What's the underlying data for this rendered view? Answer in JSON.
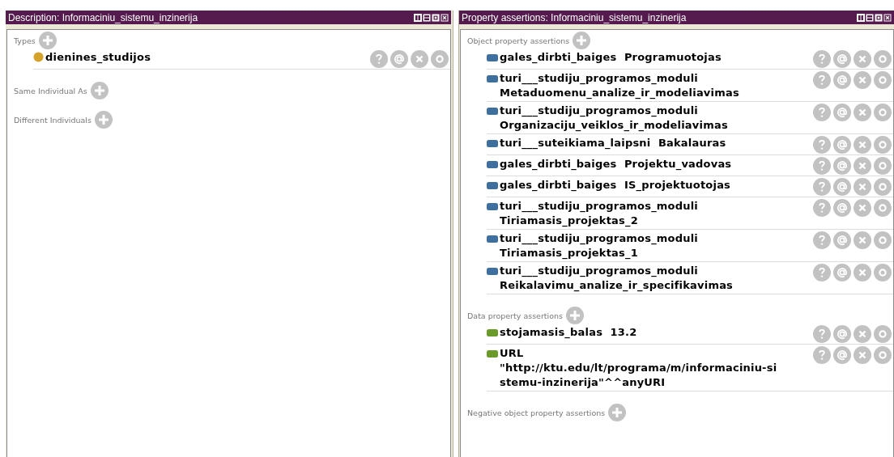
{
  "panels": [
    {
      "title": "Description: Informaciniu_sistemu_inzinerija",
      "sections": [
        {
          "label": "Types",
          "kind": "class",
          "rows": [
            {
              "lines": [
                "dienines_studijos"
              ]
            }
          ]
        },
        {
          "label": "Same Individual As"
        },
        {
          "label": "Different Individuals"
        }
      ]
    },
    {
      "title": "Property assertions: Informaciniu_sistemu_inzinerija",
      "sections": [
        {
          "label": "Object property assertions",
          "kind": "object",
          "rows": [
            {
              "lines": [
                "gales_dirbti_baiges  Programuotojas"
              ]
            },
            {
              "lines": [
                "turi___studiju_programos_moduli",
                "Metaduomenu_analize_ir_modeliavimas"
              ]
            },
            {
              "lines": [
                "turi___studiju_programos_moduli",
                "Organizaciju_veiklos_ir_modeliavimas"
              ]
            },
            {
              "lines": [
                "turi___suteikiama_laipsni  Bakalauras"
              ]
            },
            {
              "lines": [
                "gales_dirbti_baiges  Projektu_vadovas"
              ]
            },
            {
              "lines": [
                "gales_dirbti_baiges  IS_projektuotojas"
              ]
            },
            {
              "lines": [
                "turi___studiju_programos_moduli",
                "Tiriamasis_projektas_2"
              ]
            },
            {
              "lines": [
                "turi___studiju_programos_moduli",
                "Tiriamasis_projektas_1"
              ]
            },
            {
              "lines": [
                "turi___studiju_programos_moduli",
                "Reikalavimu_analize_ir_specifikavimas"
              ]
            }
          ]
        },
        {
          "label": "Data property assertions",
          "kind": "data",
          "rows": [
            {
              "lines": [
                "stojamasis_balas  13.2"
              ]
            },
            {
              "lines": [
                "URL",
                "\"http://ktu.edu/lt/programa/m/informaciniu-si",
                "stemu-inzinerija\"^^anyURI"
              ]
            }
          ]
        },
        {
          "label": "Negative object property assertions"
        }
      ]
    }
  ]
}
